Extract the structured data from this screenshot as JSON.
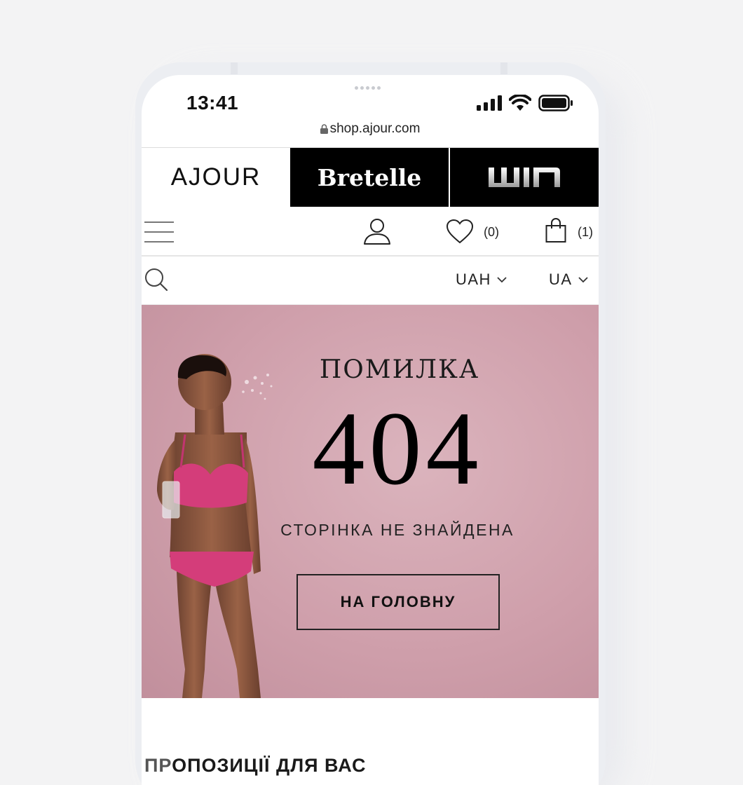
{
  "status_bar": {
    "time": "13:41",
    "url": "shop.ajour.com"
  },
  "brands": [
    {
      "name": "AJOUR"
    },
    {
      "name": "Bretelle"
    },
    {
      "name": "WIN"
    }
  ],
  "header": {
    "wishlist_count": "(0)",
    "cart_count": "(1)"
  },
  "toolbar": {
    "currency": "UAH",
    "language": "UA"
  },
  "hero": {
    "kicker": "ПОМИЛКА",
    "code": "404",
    "subtitle": "СТОРІНКА НЕ ЗНАЙДЕНА",
    "button_label": "НА ГОЛОВНУ"
  },
  "suggestions": {
    "title_prefix": "ПР",
    "title_rest": "ОПОЗИЦІЇ ДЛЯ ВАС"
  },
  "colors": {
    "hero_bg": "#cf9fab",
    "lingerie": "#d43d7a",
    "brand_bg": "#000000"
  }
}
